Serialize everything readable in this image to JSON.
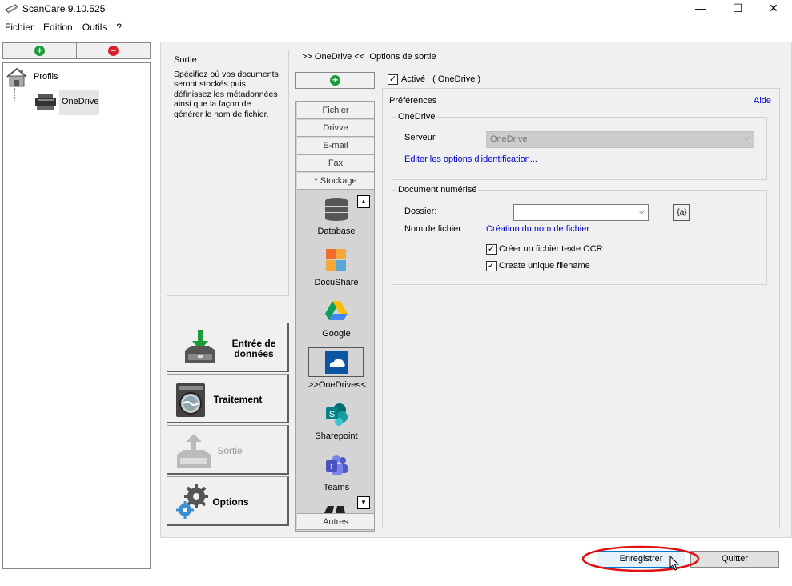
{
  "window": {
    "title": "ScanCare 9.10.525",
    "controls": {
      "minimize": "—",
      "maximize": "☐",
      "close": "✕"
    }
  },
  "menu": [
    "Fichier",
    "Edition",
    "Outils",
    "?"
  ],
  "tree": {
    "root_label": "Profils",
    "child_label": "OneDrive"
  },
  "description": {
    "title": "Sortie",
    "text": "Spécifiez où vos documents seront stockés puis définissez les métadonnées ainsi que la façon de générer le nom de fichier."
  },
  "steps": {
    "entree": "Entrée de données",
    "traitement": "Traitement",
    "sortie": "Sortie",
    "options": "Options"
  },
  "header": {
    "breadcrumb": ">> OneDrive <<",
    "section": "Options de sortie"
  },
  "tabs": [
    "Fichier",
    "Drivve",
    "E-mail",
    "Fax",
    "* Stockage"
  ],
  "services": [
    "Database",
    "DocuShare",
    "Google",
    ">>OneDrive<<",
    "Sharepoint",
    "Teams"
  ],
  "bottom_tab": "Autres",
  "options": {
    "active_label": "Activé",
    "active_service": "( OneDrive )",
    "active_checked": true,
    "preferences_label": "Préférences",
    "help_link": "Aide",
    "onedrive_group": "OneDrive",
    "server_label": "Serveur",
    "server_value": "OneDrive",
    "edit_identification": "Editer les options d'identification...",
    "document_group": "Document numérisé",
    "folder_label": "Dossier:",
    "folder_value": "",
    "variable_button": "{a}",
    "filename_label": "Nom de fichier",
    "filename_link": "Création du nom de fichier",
    "ocr_label": "Créer un fichier texte OCR",
    "ocr_checked": true,
    "unique_label": "Create unique filename",
    "unique_checked": true
  },
  "footer": {
    "save": "Enregistrer",
    "quit": "Quitter"
  },
  "colors": {
    "add_green": "#1a9c3a",
    "remove_red": "#d8232a",
    "highlight_red": "#e01010",
    "link_blue": "#0000cc"
  }
}
